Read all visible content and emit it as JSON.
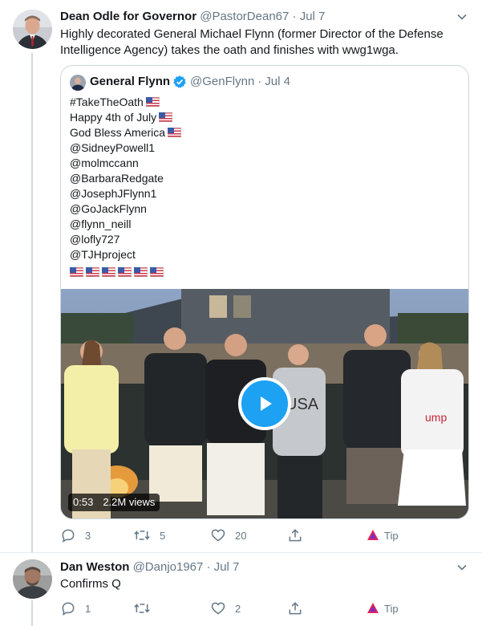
{
  "tweets": [
    {
      "author_name": "Dean Odle for Governor",
      "handle": "@PastorDean67",
      "separator": "·",
      "date": "Jul 7",
      "text_line1": "Highly decorated General Michael Flynn (former Director of the Defense",
      "text_line2": "Intelligence Agency) takes the oath and finishes with wwg1wga.",
      "actions": {
        "replies": "3",
        "retweets": "5",
        "likes": "20",
        "tip_label": "Tip"
      }
    },
    {
      "author_name": "Dan Weston",
      "handle": "@Danjo1967",
      "separator": "·",
      "date": "Jul 7",
      "text": "Confirms Q",
      "actions": {
        "replies": "1",
        "retweets": "",
        "likes": "2",
        "tip_label": "Tip"
      }
    }
  ],
  "quoted": {
    "author_name": "General Flynn",
    "handle": "@GenFlynn",
    "separator": "·",
    "date": "Jul 4",
    "lines": [
      "#TakeTheOath",
      "Happy 4th of July",
      "God Bless America",
      "@SidneyPowell1",
      "@molmccann",
      "@BarbaraRedgate",
      "@JosephJFlynn1",
      "@GoJackFlynn",
      "@flynn_neill",
      "@lofly727",
      "@TJHproject"
    ],
    "video": {
      "duration": "0:53",
      "views": "2.2M views"
    }
  },
  "icons": {
    "verified": "verified-badge-icon",
    "reply": "reply-icon",
    "retweet": "retweet-icon",
    "like": "heart-icon",
    "share": "share-icon",
    "tip": "tip-icon",
    "caret": "chevron-down-icon",
    "play": "play-icon",
    "flag": "us-flag-icon"
  },
  "colors": {
    "accent": "#1da1f2",
    "text": "#14171a",
    "secondary": "#657786",
    "tip_brand": "#e0245e"
  }
}
